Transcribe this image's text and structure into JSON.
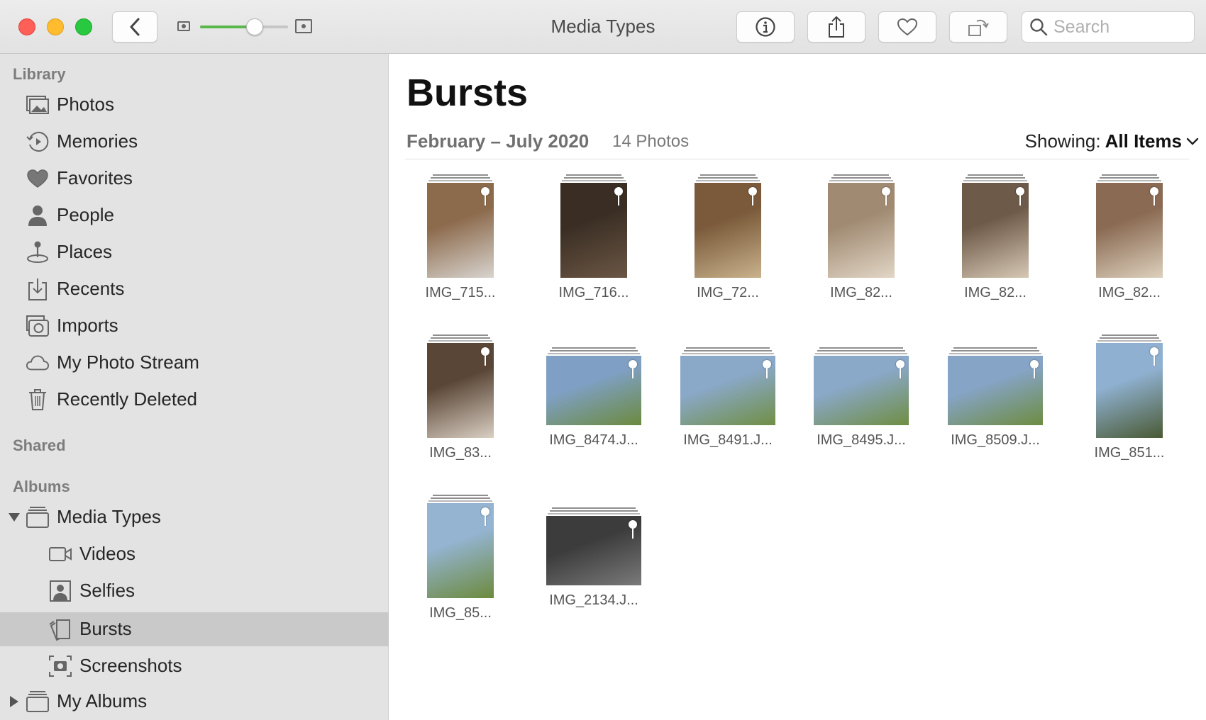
{
  "window": {
    "title": "Media Types"
  },
  "toolbar": {
    "search_placeholder": "Search",
    "zoom_level": 0.62,
    "icons": [
      "back-chevron-icon",
      "info-icon",
      "share-icon",
      "heart-icon",
      "rotate-icon",
      "search-icon"
    ]
  },
  "sidebar": {
    "library_header": "Library",
    "library": [
      {
        "label": "Photos",
        "icon": "photos-icon"
      },
      {
        "label": "Memories",
        "icon": "memories-icon"
      },
      {
        "label": "Favorites",
        "icon": "heart-icon"
      },
      {
        "label": "People",
        "icon": "person-icon"
      },
      {
        "label": "Places",
        "icon": "pin-icon"
      },
      {
        "label": "Recents",
        "icon": "recents-icon"
      },
      {
        "label": "Imports",
        "icon": "camera-icon"
      },
      {
        "label": "My Photo Stream",
        "icon": "cloud-icon"
      },
      {
        "label": "Recently Deleted",
        "icon": "trash-icon"
      }
    ],
    "shared_header": "Shared",
    "albums_header": "Albums",
    "albums": {
      "media_types": {
        "label": "Media Types",
        "expanded": true
      },
      "children": [
        {
          "label": "Videos",
          "icon": "video-icon"
        },
        {
          "label": "Selfies",
          "icon": "selfie-icon"
        },
        {
          "label": "Bursts",
          "icon": "bursts-icon",
          "selected": true
        },
        {
          "label": "Screenshots",
          "icon": "screenshot-icon"
        }
      ],
      "my_albums": {
        "label": "My Albums",
        "expanded": false
      }
    }
  },
  "main": {
    "title": "Bursts",
    "date_range": "February – July 2020",
    "count": "14 Photos",
    "showing_label": "Showing:",
    "showing_value": "All Items",
    "photos": [
      {
        "label": "IMG_715...",
        "orientation": "portrait",
        "colors": [
          "#8c6a4c",
          "#d8d4cf"
        ]
      },
      {
        "label": "IMG_716...",
        "orientation": "portrait",
        "colors": [
          "#3a2e24",
          "#6b5644"
        ]
      },
      {
        "label": "IMG_72...",
        "orientation": "portrait",
        "colors": [
          "#7a5a3a",
          "#c9b28c"
        ]
      },
      {
        "label": "IMG_82...",
        "orientation": "portrait",
        "colors": [
          "#a08a72",
          "#e2d6c6"
        ]
      },
      {
        "label": "IMG_82...",
        "orientation": "portrait",
        "colors": [
          "#6e5a48",
          "#d6c8b4"
        ]
      },
      {
        "label": "IMG_82...",
        "orientation": "portrait",
        "colors": [
          "#8a6a52",
          "#ddd0bd"
        ]
      },
      {
        "label": "IMG_83...",
        "orientation": "portrait",
        "colors": [
          "#5a4636",
          "#d9cfc3"
        ]
      },
      {
        "label": "IMG_8474.J...",
        "orientation": "landscape",
        "colors": [
          "#7fa0c4",
          "#6b8a3e"
        ]
      },
      {
        "label": "IMG_8491.J...",
        "orientation": "landscape",
        "colors": [
          "#8aa8c8",
          "#708f44"
        ]
      },
      {
        "label": "IMG_8495.J...",
        "orientation": "landscape",
        "colors": [
          "#8aa8c8",
          "#6f8e42"
        ]
      },
      {
        "label": "IMG_8509.J...",
        "orientation": "landscape",
        "colors": [
          "#86a4c6",
          "#6d8c40"
        ]
      },
      {
        "label": "IMG_851...",
        "orientation": "portrait",
        "colors": [
          "#8fb0d0",
          "#4a5a34"
        ]
      },
      {
        "label": "IMG_85...",
        "orientation": "portrait",
        "colors": [
          "#94b4d2",
          "#6c8a3c"
        ]
      },
      {
        "label": "IMG_2134.J...",
        "orientation": "landscape",
        "colors": [
          "#3c3c3c",
          "#7a7a7a"
        ]
      }
    ]
  },
  "colors": {
    "accent_green": "#5ab84b",
    "sidebar_bg": "#e3e3e3",
    "selected_bg": "#c9c9c9"
  }
}
